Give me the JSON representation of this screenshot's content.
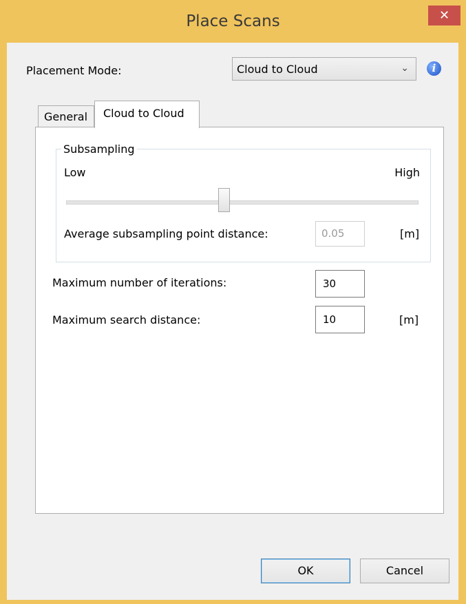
{
  "window": {
    "title": "Place Scans",
    "close_glyph": "✕"
  },
  "placement": {
    "label": "Placement Mode:",
    "selected": "Cloud to Cloud",
    "info_icon": "info-icon"
  },
  "tabs": [
    {
      "label": "General",
      "active": false
    },
    {
      "label": "Cloud to Cloud",
      "active": true
    }
  ],
  "subsampling": {
    "legend": "Subsampling",
    "low_label": "Low",
    "high_label": "High",
    "slider_level": 0.45,
    "avg_label": "Average subsampling point distance:",
    "avg_value": "0.05",
    "avg_unit": "[m]"
  },
  "iterations": {
    "label": "Maximum number of iterations:",
    "value": "30"
  },
  "search_distance": {
    "label": "Maximum search distance:",
    "value": "10",
    "unit": "[m]"
  },
  "buttons": {
    "ok": "OK",
    "cancel": "Cancel"
  },
  "colors": {
    "title_bar": "#f0c45c",
    "close_button": "#c7504a",
    "ok_border": "#3c7fb1"
  }
}
